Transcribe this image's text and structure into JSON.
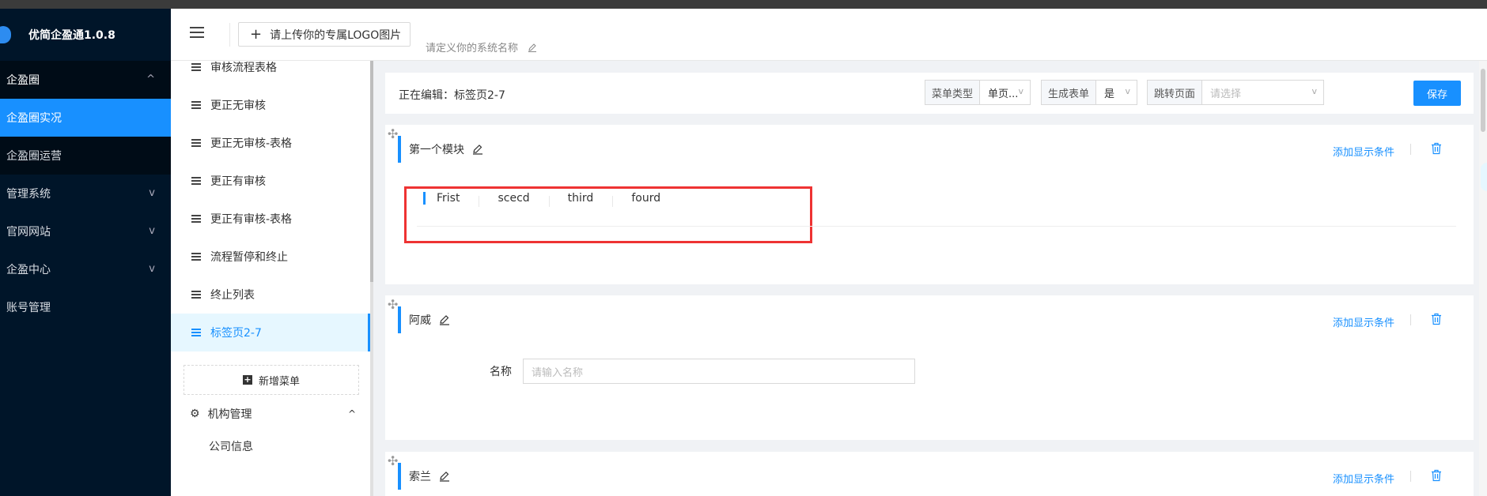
{
  "brand": {
    "name": "优简企盈通1.0.8"
  },
  "sidebar": {
    "items": [
      {
        "label": "企盈圈",
        "chevron": "^"
      },
      {
        "label": "企盈圈实况"
      },
      {
        "label": "企盈圈运营"
      },
      {
        "label": "管理系统",
        "chevron": "v"
      },
      {
        "label": "官网网站",
        "chevron": "v"
      },
      {
        "label": "企盈中心",
        "chevron": "v"
      },
      {
        "label": "账号管理"
      }
    ]
  },
  "header": {
    "logo_button": "请上传你的专属LOGO图片",
    "logo_plus": "+",
    "system_name_placeholder": "请定义你的系统名称"
  },
  "menu_list": {
    "items": [
      {
        "label": "审核流程表格"
      },
      {
        "label": "更正无审核"
      },
      {
        "label": "更正无审核-表格"
      },
      {
        "label": "更正有审核"
      },
      {
        "label": "更正有审核-表格"
      },
      {
        "label": "流程暂停和终止"
      },
      {
        "label": "终止列表"
      },
      {
        "label": "标签页2-7"
      }
    ],
    "add_menu": "新增菜单",
    "org_section": "机构管理",
    "org_chevron": "^",
    "company_info": "公司信息"
  },
  "editor": {
    "editing_label": "正在编辑：标签页2-7",
    "menu_type_label": "菜单类型",
    "menu_type_value": "单页...",
    "gen_form_label": "生成表单",
    "gen_form_value": "是",
    "jump_page_label": "跳转页面",
    "jump_page_placeholder": "请选择",
    "save": "保存",
    "caret": "v"
  },
  "modules": [
    {
      "title": "第一个模块",
      "add_condition": "添加显示条件",
      "tabs": [
        "Frist",
        "scecd",
        "third",
        "fourd"
      ]
    },
    {
      "title": "阿威",
      "add_condition": "添加显示条件",
      "field_label": "名称",
      "field_placeholder": "请输入名称"
    },
    {
      "title": "索兰",
      "add_condition": "添加显示条件"
    }
  ],
  "colors": {
    "sidebar_bg": "#001529",
    "accent": "#1890ff",
    "highlight_box": "#e33333"
  }
}
